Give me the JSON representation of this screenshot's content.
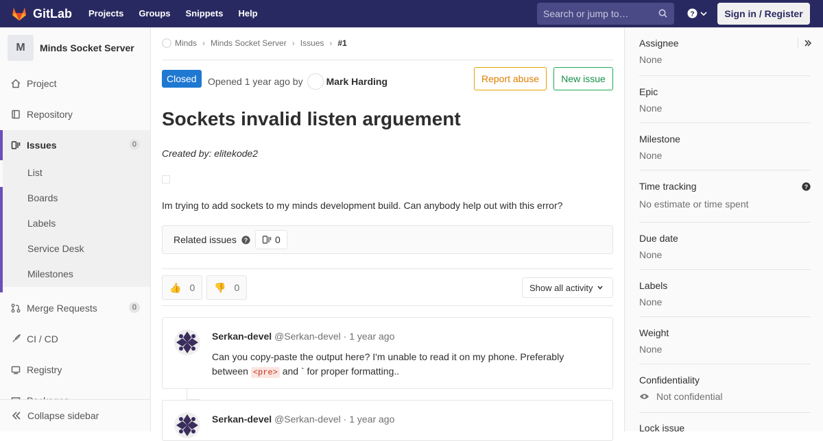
{
  "brand": {
    "name": "GitLab"
  },
  "nav": {
    "items": [
      "Projects",
      "Groups",
      "Snippets",
      "Help"
    ]
  },
  "search": {
    "placeholder": "Search or jump to…"
  },
  "signin": "Sign in / Register",
  "sidebar": {
    "avatar_letter": "M",
    "project_name": "Minds Socket Server",
    "items": [
      {
        "label": "Project",
        "icon": "home-icon"
      },
      {
        "label": "Repository",
        "icon": "book-icon"
      },
      {
        "label": "Issues",
        "icon": "issues-icon",
        "count": "0"
      },
      {
        "label": "Merge Requests",
        "icon": "merge-request-icon",
        "count": "0"
      },
      {
        "label": "CI / CD",
        "icon": "rocket-icon"
      },
      {
        "label": "Registry",
        "icon": "container-icon"
      },
      {
        "label": "Packages",
        "icon": "package-icon"
      }
    ],
    "sub_items": [
      "List",
      "Boards",
      "Labels",
      "Service Desk",
      "Milestones"
    ],
    "collapse": "Collapse sidebar"
  },
  "breadcrumbs": [
    "Minds",
    "Minds Socket Server",
    "Issues",
    "#1"
  ],
  "issue": {
    "status": "Closed",
    "opened_prefix": "Opened",
    "opened_time": "1 year ago",
    "opened_by": "by",
    "author": "Mark Harding",
    "report_abuse": "Report abuse",
    "new_issue": "New issue",
    "title": "Sockets invalid listen arguement",
    "created_by": "Created by: elitekode2",
    "description": "Im trying to add sockets to my minds development build. Can anybody help out with this error?",
    "related_label": "Related issues",
    "related_count": "0",
    "thumbs_up": "0",
    "thumbs_down": "0",
    "show_activity": "Show all activity"
  },
  "notes": [
    {
      "name": "Serkan-devel",
      "handle": "@Serkan-devel",
      "time": "1 year ago",
      "body_pre": "Can you copy-paste the output here? I'm unable to read it on my phone. Preferably between ",
      "code": "<pre>",
      "body_post": " and ` for proper formatting.."
    },
    {
      "name": "Serkan-devel",
      "handle": "@Serkan-devel",
      "time": "1 year ago"
    }
  ],
  "right": {
    "assignee": {
      "label": "Assignee",
      "value": "None"
    },
    "epic": {
      "label": "Epic",
      "value": "None"
    },
    "milestone": {
      "label": "Milestone",
      "value": "None"
    },
    "time": {
      "label": "Time tracking",
      "value": "No estimate or time spent"
    },
    "due": {
      "label": "Due date",
      "value": "None"
    },
    "labels": {
      "label": "Labels",
      "value": "None"
    },
    "weight": {
      "label": "Weight",
      "value": "None"
    },
    "conf": {
      "label": "Confidentiality",
      "value": "Not confidential"
    },
    "lock": {
      "label": "Lock issue"
    }
  },
  "colors": {
    "topbar": "#292961",
    "accent": "#6b4fbb",
    "closed": "#1f78d1",
    "abuse": "#de7e00",
    "new": "#1aaa55"
  }
}
